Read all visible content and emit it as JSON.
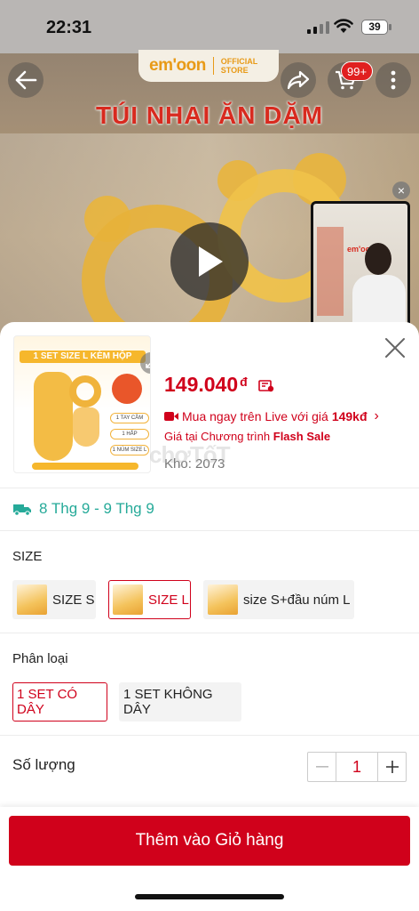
{
  "status_bar": {
    "time": "22:31",
    "battery": "39"
  },
  "header": {
    "brand_name": "em'oon",
    "brand_tag_line1": "OFFICIAL",
    "brand_tag_line2": "STORE",
    "cart_badge": "99+",
    "banner_title": "TÚI NHAI ĂN DẶM"
  },
  "live_preview": {
    "brand": "em'oon"
  },
  "product": {
    "image_banner": "1 SET SIZE L KÈM HỘP",
    "image_tags": [
      "1 TAY CẦM",
      "1 HẮP",
      "1 NÚM SIZE L"
    ],
    "price": "149.040",
    "currency": "đ",
    "live_text": "Mua ngay trên Live với giá",
    "live_price": "149kđ",
    "flash_prefix": "Giá tại Chương trình",
    "flash_label": "Flash Sale",
    "stock": "Kho: 2073",
    "watermark": "chợTốT"
  },
  "shipping": {
    "text": "8 Thg 9 - 9 Thg 9"
  },
  "size": {
    "label": "SIZE",
    "options": [
      {
        "label": "SIZE S",
        "selected": false
      },
      {
        "label": "SIZE L",
        "selected": true
      },
      {
        "label": "size S+đầu núm L",
        "selected": false
      }
    ]
  },
  "variant": {
    "label": "Phân loại",
    "options": [
      {
        "label": "1 SET CÓ DÂY",
        "selected": true
      },
      {
        "label": "1 SET KHÔNG DÂY",
        "selected": false
      }
    ]
  },
  "quantity": {
    "label": "Số lượng",
    "value": "1"
  },
  "actions": {
    "add_to_cart": "Thêm vào Giỏ hàng"
  },
  "colors": {
    "accent": "#d0011b",
    "shipping": "#26aa99",
    "brand": "#e89a17"
  }
}
